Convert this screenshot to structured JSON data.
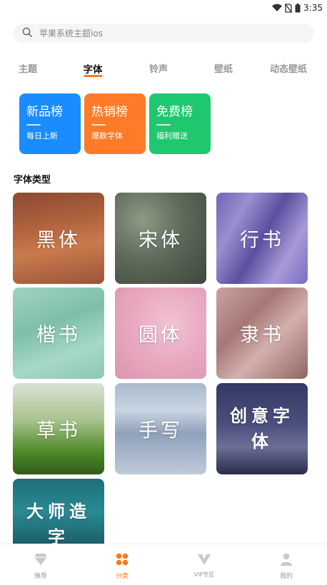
{
  "status_bar": {
    "time": "3:35",
    "icons": [
      "wifi-icon",
      "no-sim-icon",
      "battery-icon"
    ]
  },
  "search": {
    "placeholder": "苹果系统主题ios",
    "icon": "search-icon"
  },
  "tabs": [
    {
      "label": "主题",
      "active": false
    },
    {
      "label": "字体",
      "active": true
    },
    {
      "label": "铃声",
      "active": false
    },
    {
      "label": "壁纸",
      "active": false
    },
    {
      "label": "动态壁纸",
      "active": false
    }
  ],
  "rankings": [
    {
      "title": "新品榜",
      "subtitle": "每日上新",
      "color": "#1a8cff"
    },
    {
      "title": "热销榜",
      "subtitle": "爆款字体",
      "color": "#ff7a29"
    },
    {
      "title": "免费榜",
      "subtitle": "福利赠送",
      "color": "#1fc76e"
    }
  ],
  "section_title": "字体类型",
  "font_types": [
    {
      "label": "黑体"
    },
    {
      "label": "宋体"
    },
    {
      "label": "行书"
    },
    {
      "label": "楷书"
    },
    {
      "label": "圆体"
    },
    {
      "label": "隶书"
    },
    {
      "label": "草书"
    },
    {
      "label": "手写"
    },
    {
      "label": "创意字体"
    },
    {
      "label": "大师造字"
    }
  ],
  "bottom_nav": [
    {
      "label": "推荐",
      "icon": "diamond-icon",
      "active": false
    },
    {
      "label": "分类",
      "icon": "grid-icon",
      "active": true
    },
    {
      "label": "VIP专区",
      "icon": "vip-icon",
      "active": false
    },
    {
      "label": "我的",
      "icon": "user-icon",
      "active": false
    }
  ],
  "colors": {
    "accent": "#ff7a1a",
    "tab_inactive": "#999999"
  }
}
